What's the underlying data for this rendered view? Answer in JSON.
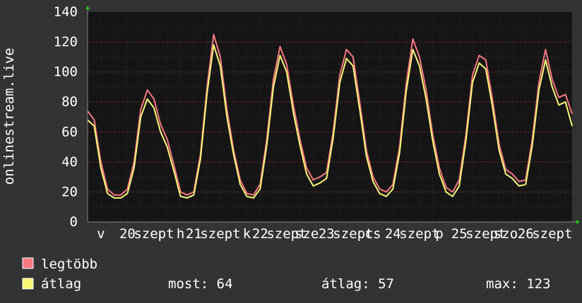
{
  "chart_data": {
    "type": "line",
    "ylabel": "onlinestream.live",
    "ylim": [
      0,
      140
    ],
    "yticks": [
      0,
      20,
      40,
      60,
      80,
      100,
      120,
      140
    ],
    "x_range": [
      0,
      7.3
    ],
    "xticks": [
      {
        "x": 0.2,
        "label": "v"
      },
      {
        "x": 0.6,
        "label": "20"
      },
      {
        "x": 1.0,
        "label": "szept"
      },
      {
        "x": 1.4,
        "label": "h"
      },
      {
        "x": 1.6,
        "label": "21"
      },
      {
        "x": 2.0,
        "label": "szept"
      },
      {
        "x": 2.4,
        "label": "k"
      },
      {
        "x": 2.6,
        "label": "22"
      },
      {
        "x": 3.0,
        "label": "szept"
      },
      {
        "x": 3.3,
        "label": "sze"
      },
      {
        "x": 3.6,
        "label": "23"
      },
      {
        "x": 4.0,
        "label": "szept"
      },
      {
        "x": 4.3,
        "label": "cs"
      },
      {
        "x": 4.6,
        "label": "24"
      },
      {
        "x": 5.0,
        "label": "szept"
      },
      {
        "x": 5.3,
        "label": "p"
      },
      {
        "x": 5.6,
        "label": "25"
      },
      {
        "x": 6.0,
        "label": "szept"
      },
      {
        "x": 6.3,
        "label": "szo"
      },
      {
        "x": 6.6,
        "label": "26"
      },
      {
        "x": 7.0,
        "label": "szept"
      }
    ],
    "grid": true,
    "series": [
      {
        "name": "legtöbb",
        "color": "#f87883",
        "x": [
          0.0,
          0.1,
          0.2,
          0.3,
          0.4,
          0.5,
          0.6,
          0.7,
          0.8,
          0.9,
          1.0,
          1.1,
          1.2,
          1.3,
          1.4,
          1.5,
          1.6,
          1.7,
          1.8,
          1.9,
          2.0,
          2.1,
          2.2,
          2.3,
          2.4,
          2.5,
          2.6,
          2.7,
          2.8,
          2.9,
          3.0,
          3.1,
          3.2,
          3.3,
          3.4,
          3.5,
          3.6,
          3.7,
          3.8,
          3.9,
          4.0,
          4.1,
          4.2,
          4.3,
          4.4,
          4.5,
          4.6,
          4.7,
          4.8,
          4.9,
          5.0,
          5.1,
          5.2,
          5.3,
          5.4,
          5.5,
          5.6,
          5.7,
          5.8,
          5.9,
          6.0,
          6.1,
          6.2,
          6.3,
          6.4,
          6.5,
          6.6,
          6.7,
          6.8,
          6.9,
          7.0,
          7.1,
          7.2,
          7.3
        ],
        "values": [
          74,
          68,
          40,
          22,
          18,
          18,
          22,
          40,
          75,
          88,
          82,
          65,
          55,
          38,
          20,
          18,
          20,
          45,
          90,
          125,
          110,
          75,
          48,
          28,
          19,
          18,
          25,
          55,
          95,
          117,
          105,
          78,
          55,
          36,
          28,
          30,
          33,
          60,
          98,
          115,
          110,
          80,
          48,
          30,
          22,
          20,
          25,
          50,
          92,
          122,
          110,
          88,
          58,
          36,
          23,
          20,
          28,
          58,
          98,
          111,
          108,
          82,
          52,
          35,
          32,
          27,
          28,
          55,
          93,
          115,
          95,
          83,
          85,
          72
        ]
      },
      {
        "name": "átlag",
        "color": "#f8f874",
        "x": [
          0.0,
          0.1,
          0.2,
          0.3,
          0.4,
          0.5,
          0.6,
          0.7,
          0.8,
          0.9,
          1.0,
          1.1,
          1.2,
          1.3,
          1.4,
          1.5,
          1.6,
          1.7,
          1.8,
          1.9,
          2.0,
          2.1,
          2.2,
          2.3,
          2.4,
          2.5,
          2.6,
          2.7,
          2.8,
          2.9,
          3.0,
          3.1,
          3.2,
          3.3,
          3.4,
          3.5,
          3.6,
          3.7,
          3.8,
          3.9,
          4.0,
          4.1,
          4.2,
          4.3,
          4.4,
          4.5,
          4.6,
          4.7,
          4.8,
          4.9,
          5.0,
          5.1,
          5.2,
          5.3,
          5.4,
          5.5,
          5.6,
          5.7,
          5.8,
          5.9,
          6.0,
          6.1,
          6.2,
          6.3,
          6.4,
          6.5,
          6.6,
          6.7,
          6.8,
          6.9,
          7.0,
          7.1,
          7.2,
          7.3
        ],
        "values": [
          68,
          64,
          36,
          19,
          16,
          16,
          19,
          36,
          70,
          82,
          76,
          60,
          50,
          34,
          17,
          16,
          18,
          42,
          86,
          118,
          104,
          70,
          45,
          25,
          17,
          16,
          22,
          51,
          90,
          111,
          100,
          73,
          51,
          32,
          24,
          26,
          29,
          56,
          93,
          109,
          104,
          75,
          44,
          27,
          19,
          17,
          22,
          46,
          87,
          115,
          104,
          82,
          54,
          32,
          20,
          17,
          24,
          54,
          93,
          106,
          102,
          77,
          48,
          32,
          29,
          24,
          25,
          51,
          88,
          108,
          90,
          78,
          80,
          64
        ]
      }
    ],
    "legend_placement": "bottom-left"
  },
  "legend": {
    "max_label": "legtöbb",
    "avg_label": "átlag",
    "now_text": "most: 64",
    "avg_text": "átlag: 57",
    "max_text": "max: 123"
  }
}
